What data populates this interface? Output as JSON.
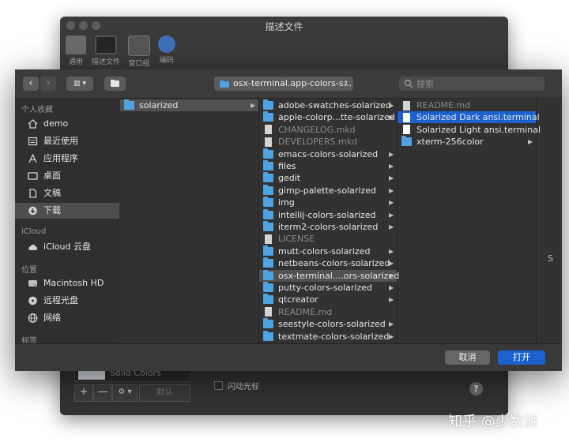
{
  "bg_window": {
    "title": "描述文件",
    "toolbar": [
      {
        "label": "通用",
        "icon": "general-icon"
      },
      {
        "label": "描述文件",
        "icon": "profiles-icon"
      },
      {
        "label": "窗口组",
        "icon": "window-groups-icon"
      },
      {
        "label": "编码",
        "icon": "encodings-icon"
      }
    ],
    "solid_colors": "Solid Colors",
    "add_label": "+",
    "remove_label": "—",
    "gear_label": "⚙ ▾",
    "default_label": "默认",
    "blink_cursor_label": "闪动光标",
    "help_label": "?"
  },
  "dialog": {
    "back_label": "‹",
    "forward_label": "›",
    "view_label": "▥ ▾",
    "path_label": "osx-terminal.app-colors-s...",
    "search_placeholder": "搜索",
    "cancel_label": "取消",
    "open_label": "打开",
    "sidebar": {
      "favorites_header": "个人收藏",
      "favorites": [
        {
          "label": "demo",
          "icon": "home-icon"
        },
        {
          "label": "最近使用",
          "icon": "recents-icon"
        },
        {
          "label": "应用程序",
          "icon": "applications-icon"
        },
        {
          "label": "桌面",
          "icon": "desktop-icon"
        },
        {
          "label": "文稿",
          "icon": "documents-icon"
        },
        {
          "label": "下载",
          "icon": "downloads-icon"
        }
      ],
      "icloud_header": "iCloud",
      "icloud": [
        {
          "label": "iCloud 云盘",
          "icon": "icloud-icon"
        }
      ],
      "locations_header": "位置",
      "locations": [
        {
          "label": "Macintosh HD",
          "icon": "harddisk-icon"
        },
        {
          "label": "远程光盘",
          "icon": "remote-disc-icon"
        },
        {
          "label": "网络",
          "icon": "network-icon"
        }
      ],
      "tags_header": "标签"
    },
    "col1": [
      {
        "label": "solarized",
        "type": "folder",
        "arrow": true
      }
    ],
    "col2": [
      {
        "label": "adobe-swatches-solarized",
        "type": "folder",
        "arrow": true
      },
      {
        "label": "apple-colorp...tte-solarized",
        "type": "folder",
        "arrow": true
      },
      {
        "label": "CHANGELOG.mkd",
        "type": "doc",
        "arrow": false
      },
      {
        "label": "DEVELOPERS.mkd",
        "type": "doc",
        "arrow": false
      },
      {
        "label": "emacs-colors-solarized",
        "type": "folder",
        "arrow": true
      },
      {
        "label": "files",
        "type": "folder",
        "arrow": true
      },
      {
        "label": "gedit",
        "type": "folder",
        "arrow": true
      },
      {
        "label": "gimp-palette-solarized",
        "type": "folder",
        "arrow": true
      },
      {
        "label": "img",
        "type": "folder",
        "arrow": true
      },
      {
        "label": "intellij-colors-solarized",
        "type": "folder",
        "arrow": true
      },
      {
        "label": "iterm2-colors-solarized",
        "type": "folder",
        "arrow": true
      },
      {
        "label": "LICENSE",
        "type": "doc",
        "arrow": false
      },
      {
        "label": "mutt-colors-solarized",
        "type": "folder",
        "arrow": true
      },
      {
        "label": "netbeans-colors-solarized",
        "type": "folder",
        "arrow": true
      },
      {
        "label": "osx-terminal....ors-solarized",
        "type": "folder",
        "arrow": true
      },
      {
        "label": "putty-colors-solarized",
        "type": "folder",
        "arrow": true
      },
      {
        "label": "qtcreator",
        "type": "folder",
        "arrow": true
      },
      {
        "label": "README.md",
        "type": "doc",
        "arrow": false
      },
      {
        "label": "seestyle-colors-solarized",
        "type": "folder",
        "arrow": true
      },
      {
        "label": "textmate-colors-solarized",
        "type": "folder",
        "arrow": true
      }
    ],
    "col3": [
      {
        "label": "README.md",
        "type": "doc",
        "arrow": false
      },
      {
        "label": "Solarized Dark ansi.terminal",
        "type": "file",
        "arrow": false
      },
      {
        "label": "Solarized Light ansi.terminal",
        "type": "file",
        "arrow": false
      },
      {
        "label": "xterm-256color",
        "type": "folder",
        "arrow": true
      }
    ],
    "col4_fragment": "S"
  },
  "watermark": "知乎 @少数派",
  "colors": {
    "accent": "#1b62cf",
    "folder": "#4fa3e0",
    "dialog_bg": "#323232"
  }
}
